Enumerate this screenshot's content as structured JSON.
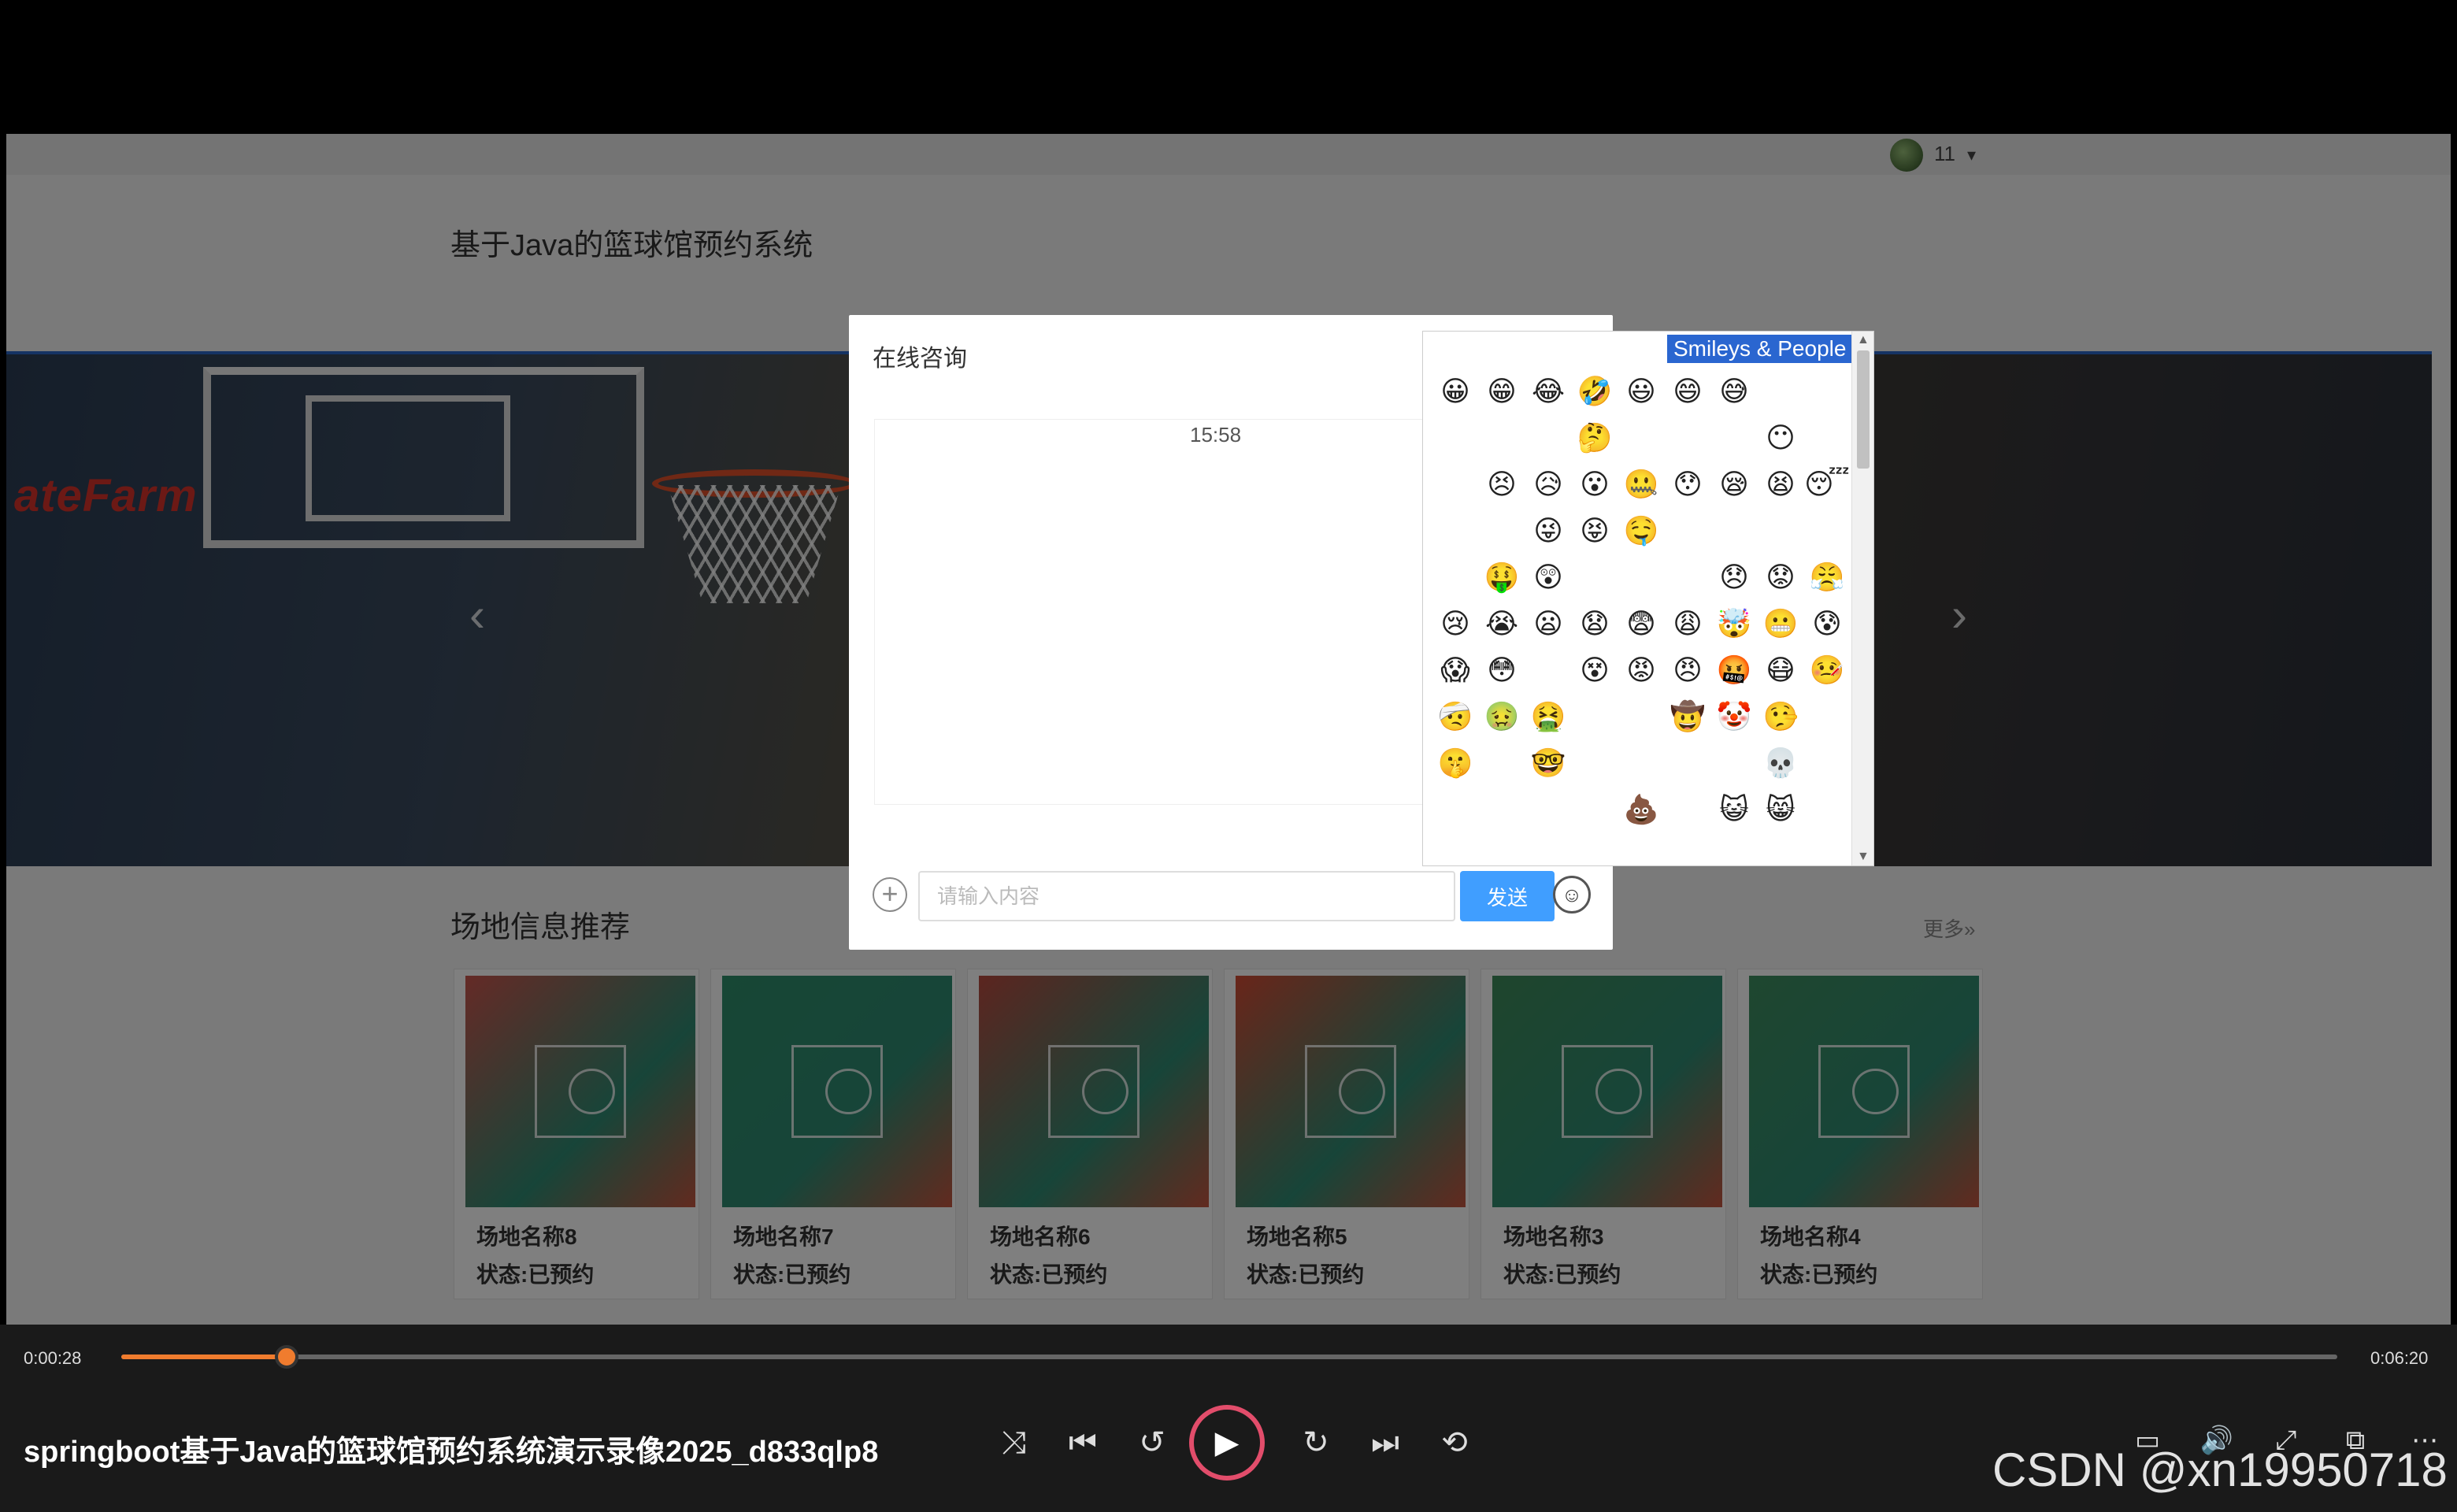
{
  "site": {
    "title": "基于Java的篮球馆预约系统",
    "user": {
      "name": "11",
      "caret": "▾"
    }
  },
  "banner": {
    "text": "ateFarm",
    "prev_icon": "‹",
    "next_icon": "›"
  },
  "section": {
    "title": "场地信息推荐",
    "more": "更多»"
  },
  "courts": [
    {
      "name": "场地名称8",
      "status": "状态:已预约",
      "color": "#c9554d"
    },
    {
      "name": "场地名称7",
      "status": "状态:已预约",
      "color": "#2f8e6a"
    },
    {
      "name": "场地名称6",
      "status": "状态:已预约",
      "color": "#b84a3f"
    },
    {
      "name": "场地名称5",
      "status": "状态:已预约",
      "color": "#d24b34"
    },
    {
      "name": "场地名称3",
      "status": "状态:已预约",
      "color": "#3e8a5a"
    },
    {
      "name": "场地名称4",
      "status": "状态:已预约",
      "color": "#3e8e5f"
    }
  ],
  "chat": {
    "title": "在线咨询",
    "time": "15:58",
    "input_placeholder": "请输入内容",
    "send_label": "发送",
    "plus_icon": "+",
    "emoji_icon": "☺"
  },
  "emoji_picker": {
    "category": "Smileys & People",
    "rows": [
      [
        "😀",
        "😁",
        "😂",
        "🤣",
        "😃",
        "😄",
        "😅",
        "",
        "",
        ""
      ],
      [
        "",
        "",
        "",
        "🤔",
        "",
        "",
        "",
        "😶",
        "",
        ""
      ],
      [
        "",
        "😣",
        "😥",
        "😮",
        "🤐",
        "😯",
        "😪",
        "😫",
        "😴",
        ""
      ],
      [
        "",
        "",
        "😜",
        "😝",
        "🤤",
        "",
        "",
        "",
        "",
        ""
      ],
      [
        "",
        "🤑",
        "😲",
        "",
        "",
        "",
        "😞",
        "😟",
        "😤",
        ""
      ],
      [
        "😢",
        "😭",
        "😦",
        "😧",
        "😨",
        "😩",
        "🤯",
        "😬",
        "😰",
        ""
      ],
      [
        "😱",
        "😳",
        "",
        "😵",
        "😡",
        "😠",
        "🤬",
        "😷",
        "🤒",
        ""
      ],
      [
        "🤕",
        "🤢",
        "🤮",
        "",
        "",
        "🤠",
        "🤡",
        "🤥",
        "",
        ""
      ],
      [
        "🤫",
        "",
        "🤓",
        "",
        "",
        "",
        "",
        "💀",
        "",
        ""
      ],
      [
        "",
        "",
        "",
        "",
        "💩",
        "",
        "😺",
        "😸",
        "",
        ""
      ]
    ]
  },
  "player": {
    "time_current": "0:00:28",
    "time_total": "0:06:20",
    "progress": 0.0745,
    "title": "springboot基于Java的篮球馆预约系统演示录像2025_d833qlp8",
    "controls": [
      "⤨",
      "⏮",
      "↺",
      "▶",
      "↻",
      "⏭",
      "⟲"
    ],
    "right_controls": [
      "▭",
      "🔊",
      "⤢",
      "⧉",
      "⋯"
    ],
    "watermark": "CSDN @xn19950718"
  }
}
